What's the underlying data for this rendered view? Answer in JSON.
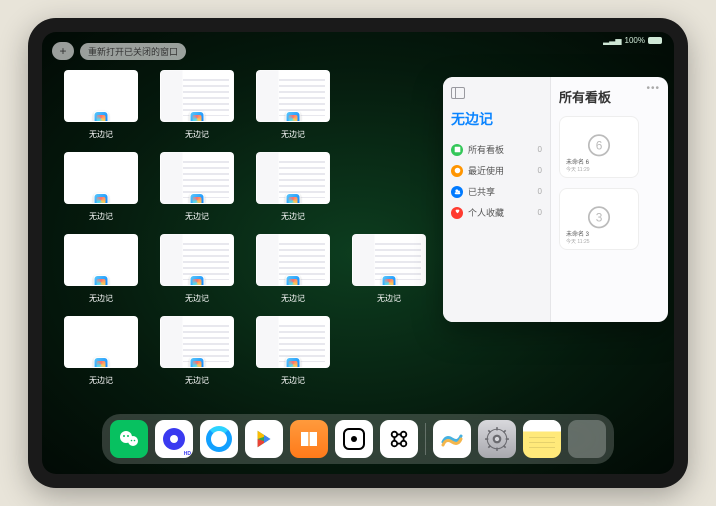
{
  "statusbar": {
    "signal": "▂▃▅",
    "battery": "100%"
  },
  "topbar": {
    "plus": "+",
    "reopen": "重新打开已关闭的窗口"
  },
  "app_label": "无边记",
  "thumbnails": [
    {
      "variant": "blank"
    },
    {
      "variant": "filled"
    },
    {
      "variant": "filled"
    },
    {
      "variant": "blank"
    },
    {
      "variant": "filled"
    },
    {
      "variant": "filled"
    },
    {
      "variant": "blank"
    },
    {
      "variant": "filled"
    },
    {
      "variant": "filled"
    },
    {
      "variant": "filled"
    },
    {
      "variant": "blank"
    },
    {
      "variant": "filled"
    },
    {
      "variant": "filled"
    }
  ],
  "front_window": {
    "sidebar_title": "无边记",
    "items": [
      {
        "icon_color": "#34c759",
        "label": "所有看板",
        "count": "0"
      },
      {
        "icon_color": "#ff9500",
        "label": "最近使用",
        "count": "0"
      },
      {
        "icon_color": "#007aff",
        "label": "已共享",
        "count": "0"
      },
      {
        "icon_color": "#ff3b30",
        "label": "个人收藏",
        "count": "0"
      }
    ],
    "main_title": "所有看板",
    "cards": [
      {
        "title": "未命名 6",
        "sub": "今天 11:29",
        "digit": "6"
      },
      {
        "title": "未命名 3",
        "sub": "今天 11:25",
        "digit": "3"
      }
    ]
  },
  "dock": {
    "wechat": "WeChat",
    "quark": "Quark",
    "qqbrowser": "QQ Browser",
    "play": "Play",
    "books": "Books",
    "dice": "Dice",
    "scan": "Scan",
    "freeform": "Freeform",
    "settings": "Settings",
    "notes": "Notes",
    "folder": "Recent Apps"
  }
}
